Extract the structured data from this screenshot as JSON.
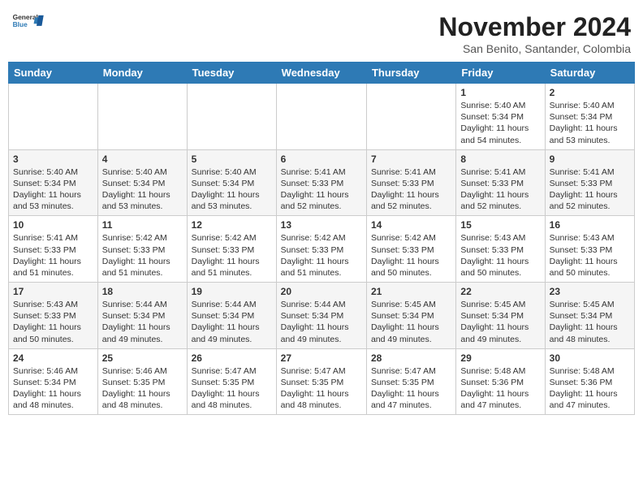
{
  "header": {
    "logo_general": "General",
    "logo_blue": "Blue",
    "month_year": "November 2024",
    "location": "San Benito, Santander, Colombia"
  },
  "days_of_week": [
    "Sunday",
    "Monday",
    "Tuesday",
    "Wednesday",
    "Thursday",
    "Friday",
    "Saturday"
  ],
  "weeks": [
    [
      {
        "day": "",
        "info": ""
      },
      {
        "day": "",
        "info": ""
      },
      {
        "day": "",
        "info": ""
      },
      {
        "day": "",
        "info": ""
      },
      {
        "day": "",
        "info": ""
      },
      {
        "day": "1",
        "info": "Sunrise: 5:40 AM\nSunset: 5:34 PM\nDaylight: 11 hours and 54 minutes."
      },
      {
        "day": "2",
        "info": "Sunrise: 5:40 AM\nSunset: 5:34 PM\nDaylight: 11 hours and 53 minutes."
      }
    ],
    [
      {
        "day": "3",
        "info": "Sunrise: 5:40 AM\nSunset: 5:34 PM\nDaylight: 11 hours and 53 minutes."
      },
      {
        "day": "4",
        "info": "Sunrise: 5:40 AM\nSunset: 5:34 PM\nDaylight: 11 hours and 53 minutes."
      },
      {
        "day": "5",
        "info": "Sunrise: 5:40 AM\nSunset: 5:34 PM\nDaylight: 11 hours and 53 minutes."
      },
      {
        "day": "6",
        "info": "Sunrise: 5:41 AM\nSunset: 5:33 PM\nDaylight: 11 hours and 52 minutes."
      },
      {
        "day": "7",
        "info": "Sunrise: 5:41 AM\nSunset: 5:33 PM\nDaylight: 11 hours and 52 minutes."
      },
      {
        "day": "8",
        "info": "Sunrise: 5:41 AM\nSunset: 5:33 PM\nDaylight: 11 hours and 52 minutes."
      },
      {
        "day": "9",
        "info": "Sunrise: 5:41 AM\nSunset: 5:33 PM\nDaylight: 11 hours and 52 minutes."
      }
    ],
    [
      {
        "day": "10",
        "info": "Sunrise: 5:41 AM\nSunset: 5:33 PM\nDaylight: 11 hours and 51 minutes."
      },
      {
        "day": "11",
        "info": "Sunrise: 5:42 AM\nSunset: 5:33 PM\nDaylight: 11 hours and 51 minutes."
      },
      {
        "day": "12",
        "info": "Sunrise: 5:42 AM\nSunset: 5:33 PM\nDaylight: 11 hours and 51 minutes."
      },
      {
        "day": "13",
        "info": "Sunrise: 5:42 AM\nSunset: 5:33 PM\nDaylight: 11 hours and 51 minutes."
      },
      {
        "day": "14",
        "info": "Sunrise: 5:42 AM\nSunset: 5:33 PM\nDaylight: 11 hours and 50 minutes."
      },
      {
        "day": "15",
        "info": "Sunrise: 5:43 AM\nSunset: 5:33 PM\nDaylight: 11 hours and 50 minutes."
      },
      {
        "day": "16",
        "info": "Sunrise: 5:43 AM\nSunset: 5:33 PM\nDaylight: 11 hours and 50 minutes."
      }
    ],
    [
      {
        "day": "17",
        "info": "Sunrise: 5:43 AM\nSunset: 5:33 PM\nDaylight: 11 hours and 50 minutes."
      },
      {
        "day": "18",
        "info": "Sunrise: 5:44 AM\nSunset: 5:34 PM\nDaylight: 11 hours and 49 minutes."
      },
      {
        "day": "19",
        "info": "Sunrise: 5:44 AM\nSunset: 5:34 PM\nDaylight: 11 hours and 49 minutes."
      },
      {
        "day": "20",
        "info": "Sunrise: 5:44 AM\nSunset: 5:34 PM\nDaylight: 11 hours and 49 minutes."
      },
      {
        "day": "21",
        "info": "Sunrise: 5:45 AM\nSunset: 5:34 PM\nDaylight: 11 hours and 49 minutes."
      },
      {
        "day": "22",
        "info": "Sunrise: 5:45 AM\nSunset: 5:34 PM\nDaylight: 11 hours and 49 minutes."
      },
      {
        "day": "23",
        "info": "Sunrise: 5:45 AM\nSunset: 5:34 PM\nDaylight: 11 hours and 48 minutes."
      }
    ],
    [
      {
        "day": "24",
        "info": "Sunrise: 5:46 AM\nSunset: 5:34 PM\nDaylight: 11 hours and 48 minutes."
      },
      {
        "day": "25",
        "info": "Sunrise: 5:46 AM\nSunset: 5:35 PM\nDaylight: 11 hours and 48 minutes."
      },
      {
        "day": "26",
        "info": "Sunrise: 5:47 AM\nSunset: 5:35 PM\nDaylight: 11 hours and 48 minutes."
      },
      {
        "day": "27",
        "info": "Sunrise: 5:47 AM\nSunset: 5:35 PM\nDaylight: 11 hours and 48 minutes."
      },
      {
        "day": "28",
        "info": "Sunrise: 5:47 AM\nSunset: 5:35 PM\nDaylight: 11 hours and 47 minutes."
      },
      {
        "day": "29",
        "info": "Sunrise: 5:48 AM\nSunset: 5:36 PM\nDaylight: 11 hours and 47 minutes."
      },
      {
        "day": "30",
        "info": "Sunrise: 5:48 AM\nSunset: 5:36 PM\nDaylight: 11 hours and 47 minutes."
      }
    ]
  ]
}
